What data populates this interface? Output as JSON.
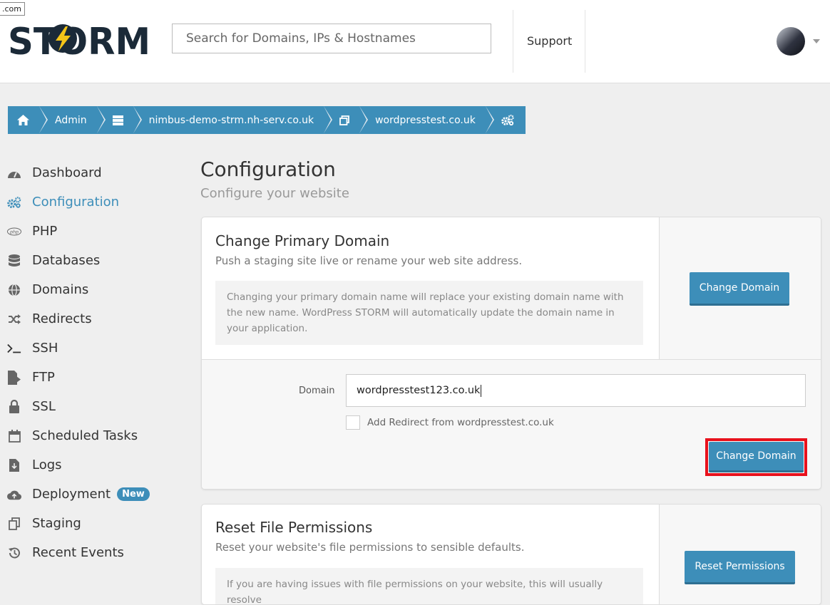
{
  "tooltip": ".com",
  "header": {
    "logo_text": "STORM",
    "search_placeholder": "Search for Domains, IPs & Hostnames",
    "support_label": "Support"
  },
  "breadcrumb": [
    {
      "icon": "home-icon",
      "label": ""
    },
    {
      "icon": "",
      "label": "Admin"
    },
    {
      "icon": "server-icon",
      "label": ""
    },
    {
      "icon": "",
      "label": "nimbus-demo-strm.nh-serv.co.uk"
    },
    {
      "icon": "window-icon",
      "label": ""
    },
    {
      "icon": "",
      "label": "wordpresstest.co.uk"
    },
    {
      "icon": "cogs-icon",
      "label": ""
    }
  ],
  "sidebar": {
    "items": [
      {
        "label": "Dashboard",
        "icon": "dashboard-icon"
      },
      {
        "label": "Configuration",
        "icon": "cogs-icon",
        "active": true
      },
      {
        "label": "PHP",
        "icon": "php-icon"
      },
      {
        "label": "Databases",
        "icon": "database-icon"
      },
      {
        "label": "Domains",
        "icon": "globe-icon"
      },
      {
        "label": "Redirects",
        "icon": "shuffle-icon"
      },
      {
        "label": "SSH",
        "icon": "terminal-icon"
      },
      {
        "label": "FTP",
        "icon": "file-upload-icon"
      },
      {
        "label": "SSL",
        "icon": "lock-icon"
      },
      {
        "label": "Scheduled Tasks",
        "icon": "calendar-icon"
      },
      {
        "label": "Logs",
        "icon": "file-download-icon"
      },
      {
        "label": "Deployment",
        "icon": "cloud-upload-icon",
        "badge": "New"
      },
      {
        "label": "Staging",
        "icon": "copy-icon"
      },
      {
        "label": "Recent Events",
        "icon": "history-icon"
      }
    ]
  },
  "page": {
    "title": "Configuration",
    "subtitle": "Configure your website"
  },
  "change_domain": {
    "title": "Change Primary Domain",
    "lead": "Push a staging site live or rename your web site address.",
    "notice": "Changing your primary domain name will replace your existing domain name with the new name. WordPress STORM will automatically update the domain name in your application.",
    "side_button": "Change Domain",
    "domain_label": "Domain",
    "domain_value": "wordpresstest123.co.uk",
    "redirect_label": "Add Redirect from wordpresstest.co.uk",
    "submit_button": "Change Domain"
  },
  "reset_permissions": {
    "title": "Reset File Permissions",
    "lead": "Reset your website's file permissions to sensible defaults.",
    "notice": "If you are having issues with file permissions on your website, this will usually resolve",
    "button": "Reset Permissions"
  },
  "colors": {
    "accent": "#3d8eb9",
    "highlight": "#e8111c",
    "logo_dark": "#1b2a38",
    "bolt": "#f5c518"
  }
}
